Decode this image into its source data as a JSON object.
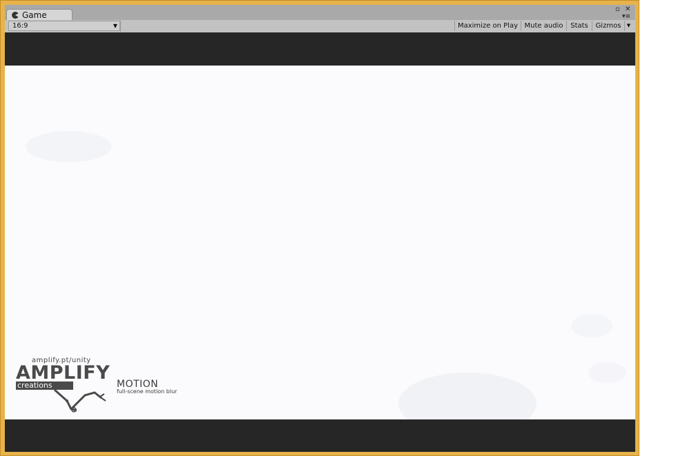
{
  "window": {
    "tab_label": "Game",
    "tab_icon": "pacman-game-icon"
  },
  "toolbar": {
    "aspect_ratio": "16:9",
    "buttons": [
      "Maximize on Play",
      "Mute audio",
      "Stats",
      "Gizmos"
    ]
  },
  "scene": {
    "logo": {
      "url": "amplify.pt/unity",
      "brand": "AMPLIFY",
      "company_label": "creations",
      "product": "MOTION",
      "tagline": "full-scene motion blur"
    }
  },
  "colors": {
    "frame_accent": "#e8b34a",
    "letterbox": "#262626",
    "scene_background": "#fbfbfd"
  }
}
